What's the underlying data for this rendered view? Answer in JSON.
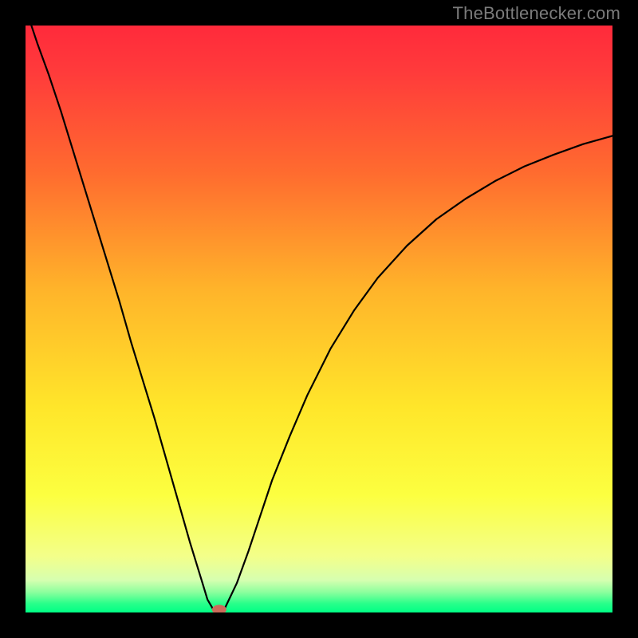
{
  "watermark": "TheBottlenecker.com",
  "chart_data": {
    "type": "line",
    "title": "",
    "xlabel": "",
    "ylabel": "",
    "xlim": [
      0,
      100
    ],
    "ylim": [
      0,
      100
    ],
    "background_gradient": [
      {
        "pos": 0.0,
        "color": "#ff2a3b"
      },
      {
        "pos": 0.08,
        "color": "#ff3b3b"
      },
      {
        "pos": 0.25,
        "color": "#ff6b2f"
      },
      {
        "pos": 0.45,
        "color": "#ffb42a"
      },
      {
        "pos": 0.65,
        "color": "#ffe62a"
      },
      {
        "pos": 0.8,
        "color": "#fcff40"
      },
      {
        "pos": 0.905,
        "color": "#f3ff8a"
      },
      {
        "pos": 0.945,
        "color": "#d6ffb0"
      },
      {
        "pos": 0.965,
        "color": "#8eff9e"
      },
      {
        "pos": 0.985,
        "color": "#28ff8a"
      },
      {
        "pos": 1.0,
        "color": "#00ff85"
      }
    ],
    "series": [
      {
        "name": "bottleneck-curve",
        "color": "#000000",
        "x": [
          0,
          2,
          4,
          6,
          8,
          10,
          12,
          14,
          16,
          18,
          20,
          22,
          24,
          26,
          28,
          30,
          31,
          32,
          33,
          34,
          36,
          38,
          40,
          42,
          45,
          48,
          52,
          56,
          60,
          65,
          70,
          75,
          80,
          85,
          90,
          95,
          100
        ],
        "y": [
          103,
          97,
          91.5,
          85.5,
          79,
          72.5,
          66,
          59.5,
          53,
          46,
          39.5,
          33,
          26,
          19,
          12,
          5.5,
          2.2,
          0.5,
          0.2,
          0.8,
          5,
          10.5,
          16.5,
          22.5,
          30,
          37,
          45,
          51.5,
          57,
          62.5,
          67,
          70.5,
          73.5,
          76,
          78,
          79.8,
          81.2
        ]
      }
    ],
    "marker": {
      "name": "optimal-point",
      "x": 33,
      "y": 0.5,
      "color": "#cc6b5a",
      "rx": 9,
      "ry": 6
    }
  }
}
